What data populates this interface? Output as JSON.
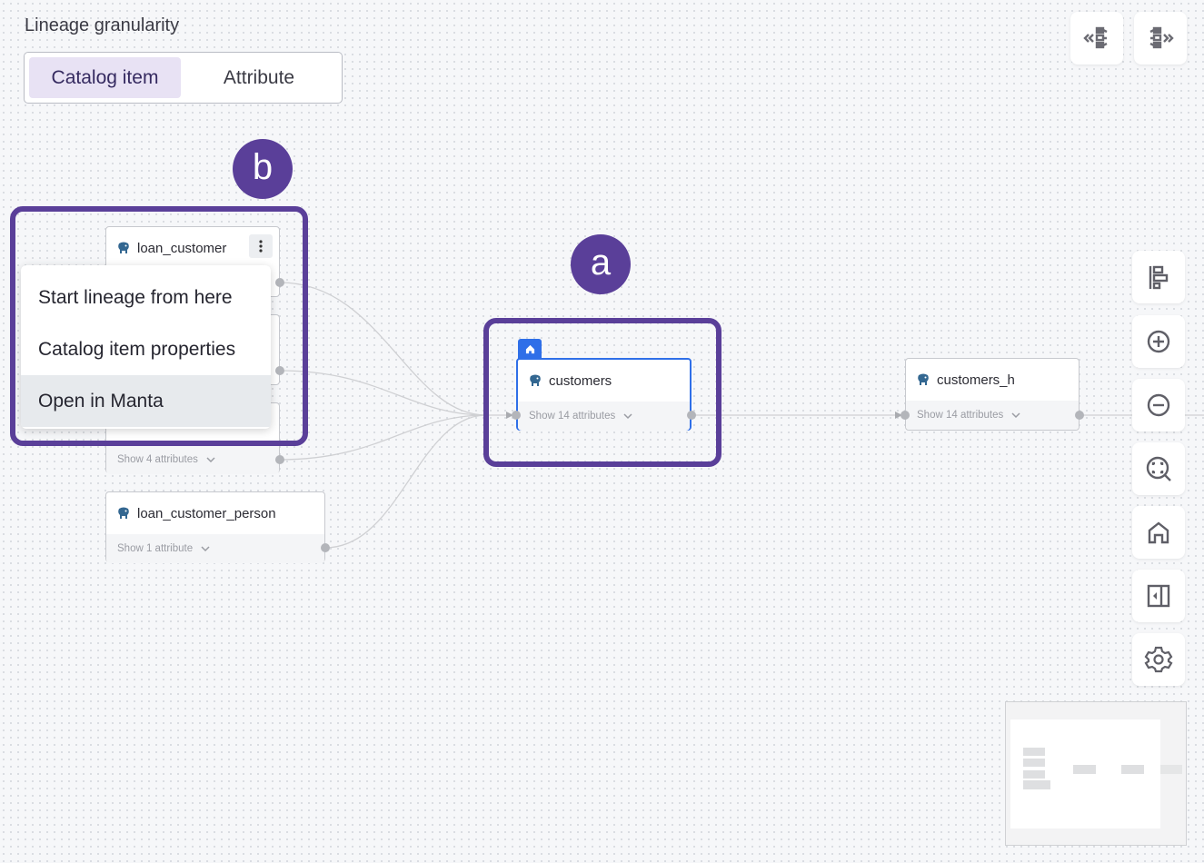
{
  "granularity": {
    "label": "Lineage granularity",
    "options": [
      "Catalog item",
      "Attribute"
    ],
    "selected": "Catalog item"
  },
  "top_toolbar": [
    {
      "name": "expand-upstream-icon",
      "tooltip": "Expand upstream"
    },
    {
      "name": "expand-downstream-icon",
      "tooltip": "Expand downstream"
    }
  ],
  "side_toolbar": [
    {
      "name": "auto-layout-icon"
    },
    {
      "name": "zoom-in-icon"
    },
    {
      "name": "zoom-out-icon"
    },
    {
      "name": "fit-view-icon"
    },
    {
      "name": "home-icon"
    },
    {
      "name": "collapse-panel-icon"
    },
    {
      "name": "settings-icon"
    }
  ],
  "nodes": {
    "loan_customer": {
      "title": "loan_customer"
    },
    "hidden_node_1": {
      "attributes": ""
    },
    "hidden_node_2": {
      "attributes": "Show 4 attributes"
    },
    "loan_customer_person": {
      "title": "loan_customer_person",
      "attributes": "Show 1 attribute"
    },
    "customers": {
      "title": "customers",
      "attributes": "Show 14 attributes",
      "is_home": true
    },
    "customers_h": {
      "title": "customers_h",
      "attributes": "Show 14 attributes"
    }
  },
  "context_menu": {
    "items": [
      "Start lineage from here",
      "Catalog item properties",
      "Open in Manta"
    ],
    "highlighted": "Open in Manta"
  },
  "annotations": {
    "a": "a",
    "b": "b",
    "color": "#5a3f99"
  },
  "colors": {
    "home_accent": "#2f6fe8",
    "selected_segment": "#e8e2f4"
  }
}
